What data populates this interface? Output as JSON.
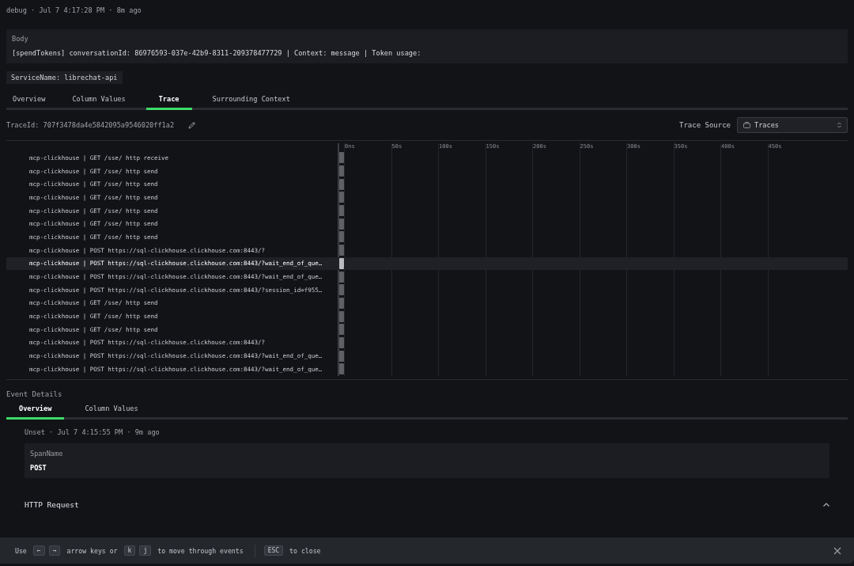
{
  "header": "debug · Jul 7 4:17:28 PM · 8m ago",
  "body": {
    "label": "Body",
    "text": "[spendTokens] conversationId: 86976593-037e-42b9-8311-209378477729 | Context: message | Token usage:"
  },
  "service_tag": "ServiceName: librechat-api",
  "tabs": [
    {
      "label": "Overview",
      "selected": false
    },
    {
      "label": "Column Values",
      "selected": false
    },
    {
      "label": "Trace",
      "selected": true
    },
    {
      "label": "Surrounding Context",
      "selected": false
    }
  ],
  "trace": {
    "trace_id": "TraceId: 707f3478da4e5842095a9546020ff1a2",
    "source_label": "Trace Source",
    "source_value": "Traces",
    "ticks": [
      "0ns",
      "50s",
      "100s",
      "150s",
      "200s",
      "250s",
      "300s",
      "350s",
      "400s",
      "450s"
    ],
    "spans": [
      {
        "name": "mcp-clickhouse | GET /sse/ http receive",
        "selected": false
      },
      {
        "name": "mcp-clickhouse | GET /sse/ http send",
        "selected": false
      },
      {
        "name": "mcp-clickhouse | GET /sse/ http send",
        "selected": false
      },
      {
        "name": "mcp-clickhouse | GET /sse/ http send",
        "selected": false
      },
      {
        "name": "mcp-clickhouse | GET /sse/ http send",
        "selected": false
      },
      {
        "name": "mcp-clickhouse | GET /sse/ http send",
        "selected": false
      },
      {
        "name": "mcp-clickhouse | GET /sse/ http send",
        "selected": false
      },
      {
        "name": "mcp-clickhouse | POST https://sql-clickhouse.clickhouse.com:8443/?",
        "selected": false
      },
      {
        "name": "mcp-clickhouse | POST https://sql-clickhouse.clickhouse.com:8443/?wait_end_of_que…",
        "selected": true
      },
      {
        "name": "mcp-clickhouse | POST https://sql-clickhouse.clickhouse.com:8443/?wait_end_of_que…",
        "selected": false
      },
      {
        "name": "mcp-clickhouse | POST https://sql-clickhouse.clickhouse.com:8443/?session_id=f955…",
        "selected": false
      },
      {
        "name": "mcp-clickhouse | GET /sse/ http send",
        "selected": false
      },
      {
        "name": "mcp-clickhouse | GET /sse/ http send",
        "selected": false
      },
      {
        "name": "mcp-clickhouse | GET /sse/ http send",
        "selected": false
      },
      {
        "name": "mcp-clickhouse | POST https://sql-clickhouse.clickhouse.com:8443/?",
        "selected": false
      },
      {
        "name": "mcp-clickhouse | POST https://sql-clickhouse.clickhouse.com:8443/?wait_end_of_que…",
        "selected": false
      },
      {
        "name": "mcp-clickhouse | POST https://sql-clickhouse.clickhouse.com:8443/?wait_end_of_que…",
        "selected": false
      }
    ]
  },
  "event_details": {
    "title": "Event Details",
    "tabs": [
      {
        "label": "Overview",
        "selected": true
      },
      {
        "label": "Column Values",
        "selected": false
      }
    ],
    "meta": "Unset · Jul 7 4:15:55 PM · 9m ago",
    "field": {
      "label": "SpanName",
      "value": "POST"
    },
    "section": {
      "title": "HTTP Request",
      "expanded": true
    }
  },
  "footer": {
    "groups": [
      [
        {
          "kind": "text",
          "text": "Use"
        },
        {
          "kind": "key",
          "text": "←"
        },
        {
          "kind": "key",
          "text": "→"
        },
        {
          "kind": "text",
          "text": "arrow keys or"
        },
        {
          "kind": "key",
          "text": "k"
        },
        {
          "kind": "key",
          "text": "j"
        },
        {
          "kind": "text",
          "text": "to move through events"
        }
      ],
      [
        {
          "kind": "key",
          "text": "ESC"
        },
        {
          "kind": "text",
          "text": "to close"
        }
      ]
    ]
  }
}
